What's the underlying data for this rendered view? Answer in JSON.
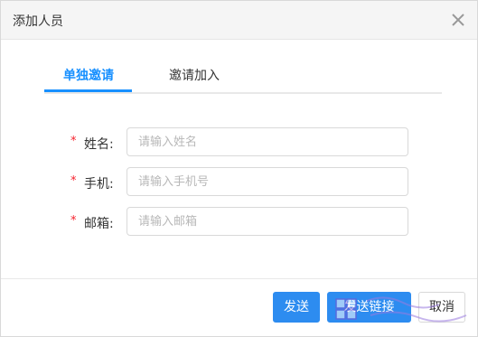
{
  "dialog": {
    "title": "添加人员",
    "close_icon": "close-icon"
  },
  "tabs": [
    {
      "label": "单独邀请",
      "active": true
    },
    {
      "label": "邀请加入",
      "active": false
    }
  ],
  "form": {
    "name": {
      "required_mark": "*",
      "label": "姓名:",
      "placeholder": "请输入姓名",
      "value": ""
    },
    "phone": {
      "required_mark": "*",
      "label": "手机:",
      "placeholder": "请输入手机号",
      "value": ""
    },
    "email": {
      "required_mark": "*",
      "label": "邮箱:",
      "placeholder": "请输入邮箱",
      "value": ""
    }
  },
  "footer": {
    "send_label": "发送",
    "send_link_label": "发送链接",
    "cancel_label": "取消"
  },
  "colors": {
    "accent": "#2d8cf0",
    "required": "#f5222d"
  }
}
